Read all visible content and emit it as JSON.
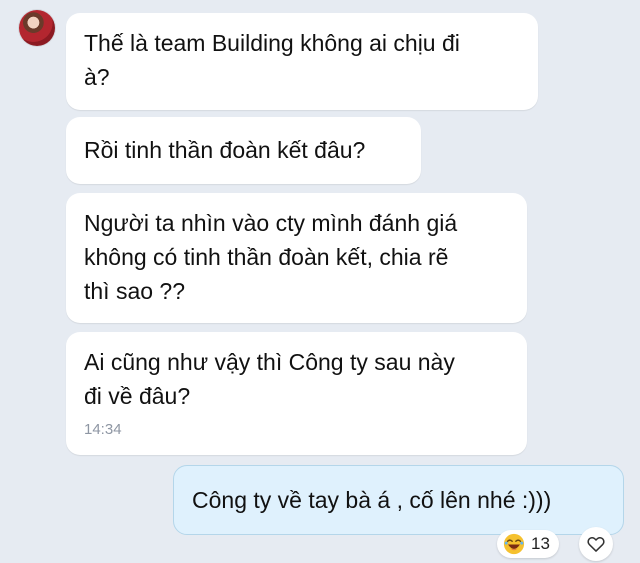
{
  "messages": [
    {
      "text": "Thế là team Building không ai chịu đi\nà?"
    },
    {
      "text": "Rồi tinh thần đoàn kết đâu?"
    },
    {
      "text": "Người ta nhìn vào cty mình đánh giá\nkhông có tinh thần đoàn kết, chia rẽ\nthì sao ??"
    },
    {
      "text": "Ai cũng như vậy thì Công ty sau này\nđi về đâu?",
      "time": "14:34"
    }
  ],
  "reply": {
    "text": "Công ty về tay bà á , cố lên nhé :)))",
    "reaction_icon": "laugh-emoji-icon",
    "reaction_count": "13",
    "heart_icon": "heart-icon"
  },
  "colors": {
    "background": "#e6ebf2",
    "incoming_bubble": "#ffffff",
    "outgoing_bubble": "#dff1fd",
    "timestamp": "#8e96a3"
  }
}
